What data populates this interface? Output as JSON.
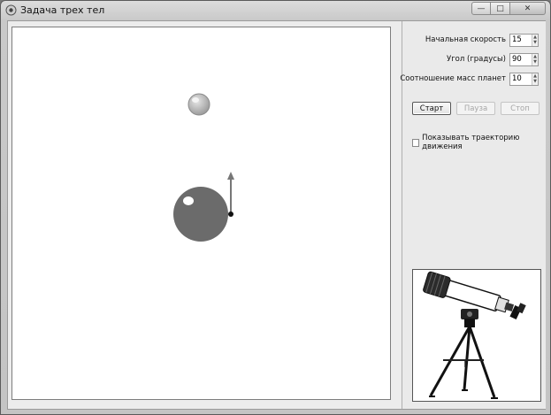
{
  "window": {
    "title": "Задача трех тел"
  },
  "panel": {
    "fields": [
      {
        "label": "Начальная скорость",
        "value": "15"
      },
      {
        "label": "Угол (градусы)",
        "value": "90"
      },
      {
        "label": "Соотношение масс планет",
        "value": "10"
      }
    ],
    "buttons": {
      "start": "Старт",
      "pause": "Пауза",
      "stop": "Стоп"
    },
    "show_trajectory": {
      "label": "Показывать траекторию движения",
      "checked": false
    }
  },
  "colors": {
    "large_planet": "#6a6a6a",
    "small_planet": "#a8a8a8",
    "velocity_arrow": "#777777"
  }
}
